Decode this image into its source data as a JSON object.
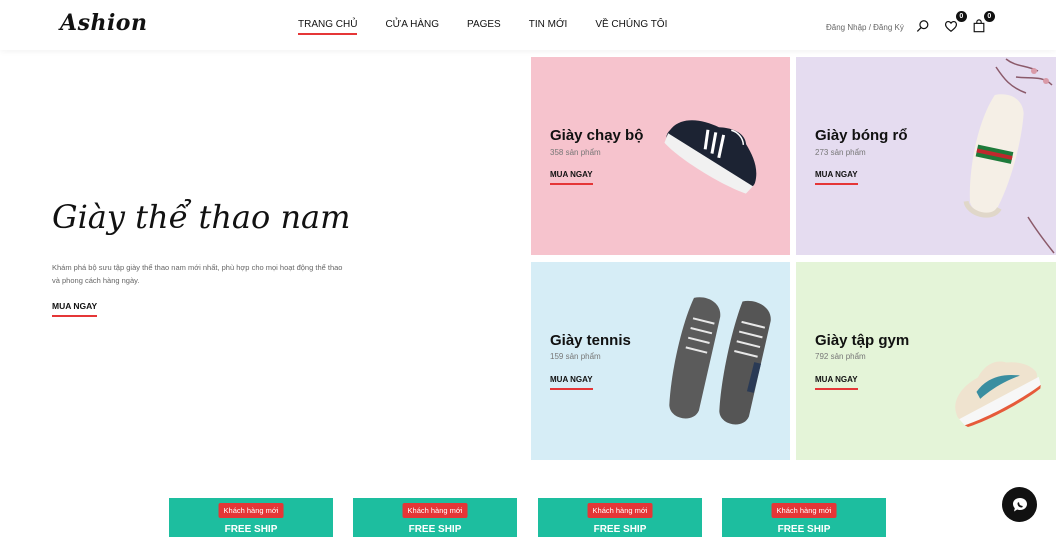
{
  "brand": {
    "logo": "Ashion"
  },
  "nav": {
    "items": [
      {
        "label": "TRANG CHỦ",
        "active": true
      },
      {
        "label": "CỬA HÀNG",
        "active": false
      },
      {
        "label": "PAGES",
        "active": false
      },
      {
        "label": "TIN MỚI",
        "active": false
      },
      {
        "label": "VỀ CHÚNG TÔI",
        "active": false
      }
    ]
  },
  "header": {
    "auth_text": "Đăng Nhập / Đăng Ký",
    "search_icon": "search-icon",
    "wishlist": {
      "icon": "heart-icon",
      "count": "0"
    },
    "cart": {
      "icon": "bag-icon",
      "count": "0"
    }
  },
  "hero": {
    "title": "Giày thể thao nam",
    "description": "Khám phá bộ sưu tập giày thể thao nam mới nhất, phù hợp cho mọi hoạt động thể thao và phong cách hàng ngày.",
    "cta": "MUA NGAY"
  },
  "categories": [
    {
      "title": "Giày chạy bộ",
      "count": "358 sản phẩm",
      "cta": "MUA NGAY",
      "bg": "#f6c3cd"
    },
    {
      "title": "Giày bóng rổ",
      "count": "273 sản phẩm",
      "cta": "MUA NGAY",
      "bg": "#e5dcf0"
    },
    {
      "title": "Giày tennis",
      "count": "159 sản phẩm",
      "cta": "MUA NGAY",
      "bg": "#d6edf6"
    },
    {
      "title": "Giày tập gym",
      "count": "792 sản phẩm",
      "cta": "MUA NGAY",
      "bg": "#e4f4d8"
    }
  ],
  "promos": [
    {
      "badge": "Khách hàng mới",
      "text": "FREE SHIP"
    },
    {
      "badge": "Khách hàng mới",
      "text": "FREE SHIP"
    },
    {
      "badge": "Khách hàng mới",
      "text": "FREE SHIP"
    },
    {
      "badge": "Khách hàng mới",
      "text": "FREE SHIP"
    }
  ],
  "colors": {
    "accent": "#e53637",
    "promo": "#1dbe9f",
    "text": "#111111"
  },
  "chat": {
    "icon": "chat-icon"
  }
}
